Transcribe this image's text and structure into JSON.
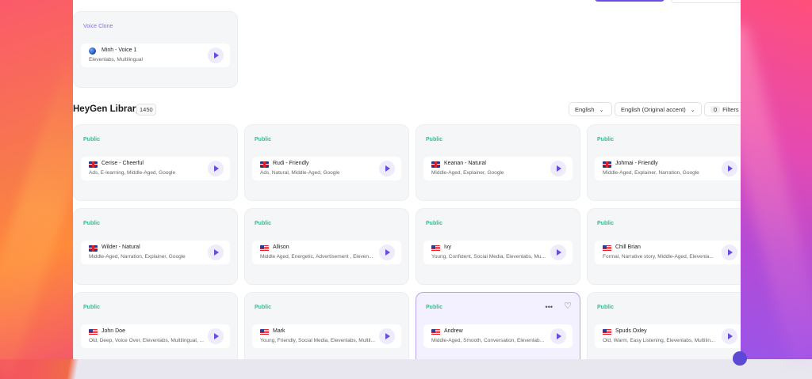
{
  "voice_clone": {
    "tag": "Voice Clone",
    "voice": {
      "name": "Minh - Voice 1",
      "tags": "Elevenlabs, Multilingual"
    }
  },
  "library": {
    "title": "HeyGen Library",
    "count": "1450",
    "language_filter": "English",
    "accent_filter": "English (Original accent)",
    "filters_count": "0",
    "filters_label": "Filters"
  },
  "voices": [
    {
      "tag": "Public",
      "flag": "uk",
      "name": "Cerise - Cheerful",
      "tags": "Ads, E-learning, Middle-Aged, Google"
    },
    {
      "tag": "Public",
      "flag": "uk",
      "name": "Rudi - Friendly",
      "tags": "Ads, Natural, Middle-Aged, Google"
    },
    {
      "tag": "Public",
      "flag": "uk",
      "name": "Keanan - Natural",
      "tags": "Middle-Aged, Explainer, Google"
    },
    {
      "tag": "Public",
      "flag": "uk",
      "name": "Johmai - Friendly",
      "tags": "Middle-Aged, Explainer, Narration, Google"
    },
    {
      "tag": "Public",
      "flag": "uk",
      "name": "Wilder - Natural",
      "tags": "Middle-Aged, Narration, Explainer, Google"
    },
    {
      "tag": "Public",
      "flag": "us",
      "name": "Allison",
      "tags": "Middle Aged, Energetic, Advertisement , Eleven..."
    },
    {
      "tag": "Public",
      "flag": "us",
      "name": "Ivy",
      "tags": "Young, Confident, Social Media, Elevenlabs, Mu..."
    },
    {
      "tag": "Public",
      "flag": "us",
      "name": "Chill Brian",
      "tags": "Formal, Narrative story, Middle-Aged, Elevenla..."
    },
    {
      "tag": "Public",
      "flag": "us",
      "name": "John Doe",
      "tags": "Old, Deep, Voice Over, Elevenlabs, Multilingual, ..."
    },
    {
      "tag": "Public",
      "flag": "us",
      "name": "Mark",
      "tags": "Young, Friendly, Social Media, Elevenlabs, Multil..."
    },
    {
      "tag": "Public",
      "flag": "us",
      "name": "Andrew",
      "tags": "Middle-Aged, Smooth, Conversation, Elevenlab..."
    },
    {
      "tag": "Public",
      "flag": "us",
      "name": "Spuds Oxley",
      "tags": "Old, Warm, Easy Listening, Elevenlabs, Multilin..."
    }
  ],
  "icons": {
    "play": "play-icon",
    "more": "more-icon",
    "favorite": "heart-icon"
  },
  "colors": {
    "accent": "#6a4be0",
    "public_tag": "#2fc08a",
    "selected_border": "#b9a4f3"
  }
}
